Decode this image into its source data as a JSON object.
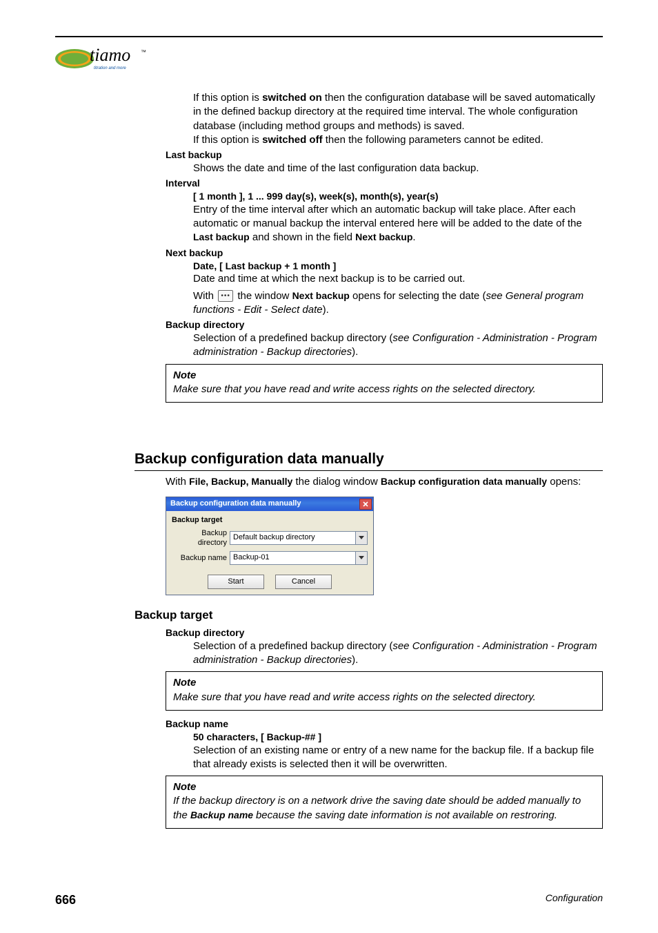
{
  "logo": {
    "brand": "tiamo",
    "tm": "™",
    "tagline": "titration and more"
  },
  "sec1": {
    "p1a": "If this option is ",
    "p1b": "switched on",
    "p1c": " then the configuration database will be saved automatically in the defined backup directory at the required time interval. The whole configuration database (including method groups and methods) is saved.",
    "p2a": "If this option is ",
    "p2b": "switched off",
    "p2c": " then the following parameters cannot be edited.",
    "lastbackup_label": "Last backup",
    "lastbackup_text": "Shows the date and time of the last configuration data backup.",
    "interval_label": "Interval",
    "interval_range": "[ 1 month ], 1 ... 999 day(s), week(s), month(s), year(s)",
    "interval_text_a": "Entry of the time interval after which an automatic backup will take place. After each automatic or manual backup the interval entered here will be added to the date of the ",
    "interval_text_b": "Last backup",
    "interval_text_c": " and shown in the field ",
    "interval_text_d": "Next backup",
    "interval_text_e": ".",
    "nextbackup_label": "Next backup",
    "nextbackup_range": "Date, [ Last backup + 1 month ]",
    "nextbackup_text1": "Date and time at which the next backup is to be carried out.",
    "nextbackup_with_a": "With ",
    "nextbackup_with_b": " the window ",
    "nextbackup_with_c": "Next backup",
    "nextbackup_with_d": " opens for selecting the date (",
    "nextbackup_with_e": "see General program functions - Edit - Select date",
    "nextbackup_with_f": ").",
    "backupdir_label": "Backup directory",
    "backupdir_text_a": "Selection of a predefined backup directory (",
    "backupdir_text_b": "see Configuration - Administration - Program administration - Backup directories",
    "backupdir_text_c": ").",
    "note_title": "Note",
    "note_text": "Make sure that you have read and write access rights on the selected directory."
  },
  "sec2": {
    "heading": "Backup configuration data manually",
    "intro_a": "With ",
    "intro_b": "File, Backup, Manually",
    "intro_c": " the dialog window ",
    "intro_d": "Backup configuration data manually",
    "intro_e": " opens:",
    "dialog": {
      "title": "Backup configuration data manually",
      "group": "Backup target",
      "row1_label": "Backup directory",
      "row1_value": "Default backup directory",
      "row2_label": "Backup name",
      "row2_value": "Backup-01",
      "start": "Start",
      "cancel": "Cancel"
    },
    "target_heading": "Backup target",
    "backupdir_label": "Backup directory",
    "backupdir_text_a": "Selection of a predefined backup directory (",
    "backupdir_text_b": "see Configuration - Administration - Program administration - Backup directories",
    "backupdir_text_c": ").",
    "note1_title": "Note",
    "note1_text": "Make sure that you have read and write access rights on the selected directory.",
    "backupname_label": "Backup name",
    "backupname_range": "50 characters, [ Backup-## ]",
    "backupname_text": "Selection of an existing name or entry of a new name for the backup file. If a backup file that already exists is selected then it will be overwritten.",
    "note2_title": "Note",
    "note2_text_a": "If the backup directory is on a network drive the saving date should be added manually to the ",
    "note2_text_b": "Backup name ",
    "note2_text_c": "because the saving date information is not available on restroring."
  },
  "footer": {
    "page": "666",
    "label": "Configuration"
  }
}
